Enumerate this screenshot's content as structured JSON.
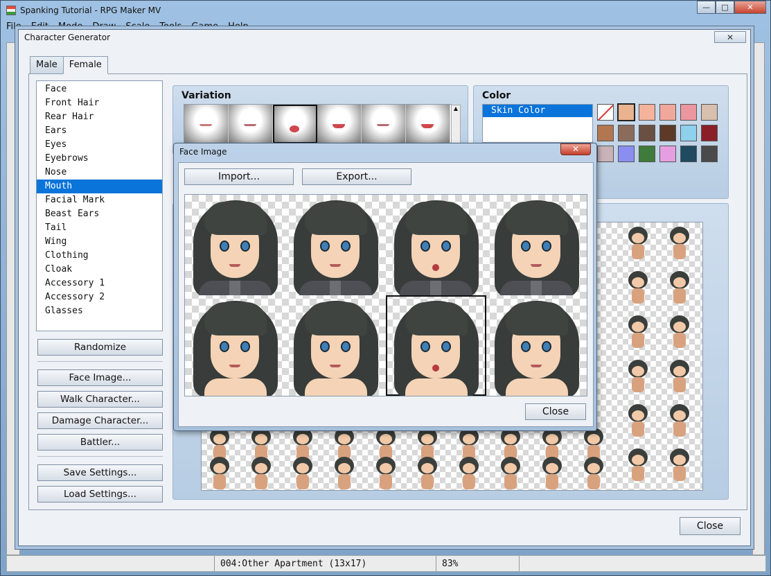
{
  "app": {
    "title": "Spanking Tutorial - RPG Maker MV",
    "menu": [
      "File",
      "Edit",
      "Mode",
      "Draw",
      "Scale",
      "Tools",
      "Game",
      "Help"
    ],
    "status_map": "004:Other Apartment (13x17)",
    "status_zoom": "83%"
  },
  "generator": {
    "title": "Character Generator",
    "close_x": "✕",
    "tabs": [
      "Male",
      "Female"
    ],
    "active_tab": "Female",
    "parts": [
      "Face",
      "Front Hair",
      "Rear Hair",
      "Ears",
      "Eyes",
      "Eyebrows",
      "Nose",
      "Mouth",
      "Facial Mark",
      "Beast Ears",
      "Tail",
      "Wing",
      "Clothing",
      "Cloak",
      "Accessory 1",
      "Accessory 2",
      "Glasses"
    ],
    "selected_part": "Mouth",
    "buttons": {
      "randomize": "Randomize",
      "face_image": "Face Image...",
      "walk_character": "Walk Character...",
      "damage_character": "Damage Character...",
      "battler": "Battler...",
      "save_settings": "Save Settings...",
      "load_settings": "Load Settings...",
      "close": "Close"
    },
    "variation_title": "Variation",
    "color_title": "Color",
    "color_list": [
      "Skin Color"
    ],
    "swatch_colors": [
      "none",
      "#e9b38f",
      "#f4b39a",
      "#f1a89c",
      "#ec96a0",
      "#d8bfae",
      "#b27650",
      "#8b6c5c",
      "#6a5042",
      "#5c3a27",
      "#8fd0ec",
      "#8b1f29",
      "#c9b3b8",
      "#8a8ef0",
      "#3f7b3a",
      "#e59fe0",
      "#1f4a5f",
      "#4a4a4a"
    ],
    "selected_swatch": 1
  },
  "face_image": {
    "title": "Face Image",
    "close_x": "✕",
    "import": "Import...",
    "export": "Export...",
    "close": "Close"
  }
}
